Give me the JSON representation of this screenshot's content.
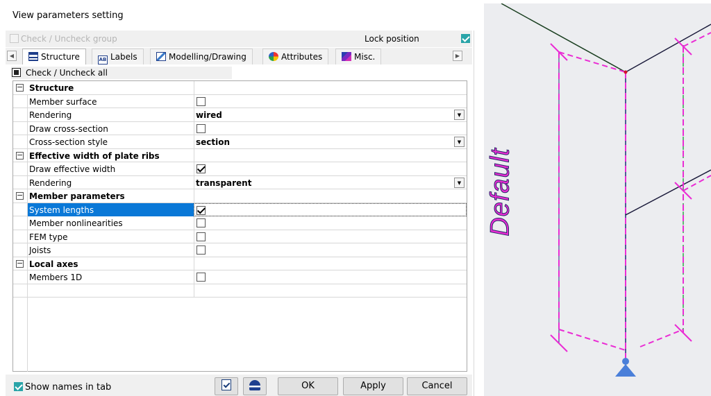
{
  "dialog": {
    "title": "View parameters setting",
    "check_group_label": "Check / Uncheck group",
    "lock_position_label": "Lock position",
    "lock_position_checked": true,
    "tabs": [
      {
        "label": "Structure",
        "icon": "structure-icon",
        "active": true
      },
      {
        "label": "Labels",
        "icon": "labels-icon",
        "active": false
      },
      {
        "label": "Modelling/Drawing",
        "icon": "modelling-drawing-icon",
        "active": false
      },
      {
        "label": "Attributes",
        "icon": "attributes-icon",
        "active": false
      },
      {
        "label": "Misc.",
        "icon": "misc-icon",
        "active": false
      }
    ],
    "check_all_label": "Check / Uncheck all",
    "grid": {
      "groups": [
        {
          "title": "Structure",
          "rows": [
            {
              "name": "Member surface",
              "type": "checkbox",
              "checked": false
            },
            {
              "name": "Rendering",
              "type": "select",
              "value": "wired"
            },
            {
              "name": "Draw cross-section",
              "type": "checkbox",
              "checked": false
            },
            {
              "name": "Cross-section style",
              "type": "select",
              "value": "section"
            }
          ]
        },
        {
          "title": "Effective width of plate ribs",
          "rows": [
            {
              "name": "Draw effective width",
              "type": "checkbox",
              "checked": true
            },
            {
              "name": "Rendering",
              "type": "select",
              "value": "transparent"
            }
          ]
        },
        {
          "title": "Member parameters",
          "rows": [
            {
              "name": "System lengths",
              "type": "checkbox",
              "checked": true,
              "selected": true
            },
            {
              "name": "Member nonlinearities",
              "type": "checkbox",
              "checked": false
            },
            {
              "name": "FEM type",
              "type": "checkbox",
              "checked": false
            },
            {
              "name": "Joists",
              "type": "checkbox",
              "checked": false
            }
          ]
        },
        {
          "title": "Local axes",
          "rows": [
            {
              "name": "Members 1D",
              "type": "checkbox",
              "checked": false
            }
          ]
        }
      ]
    },
    "show_names_label": "Show names in tab",
    "show_names_checked": true,
    "buttons": {
      "ok": "OK",
      "apply": "Apply",
      "cancel": "Cancel"
    }
  },
  "viewport": {
    "label": "Default",
    "colors": {
      "accent": "#ea2cd4",
      "member": "#1e2a78",
      "green": "#2ea84a",
      "support": "#4a7fd9"
    }
  }
}
